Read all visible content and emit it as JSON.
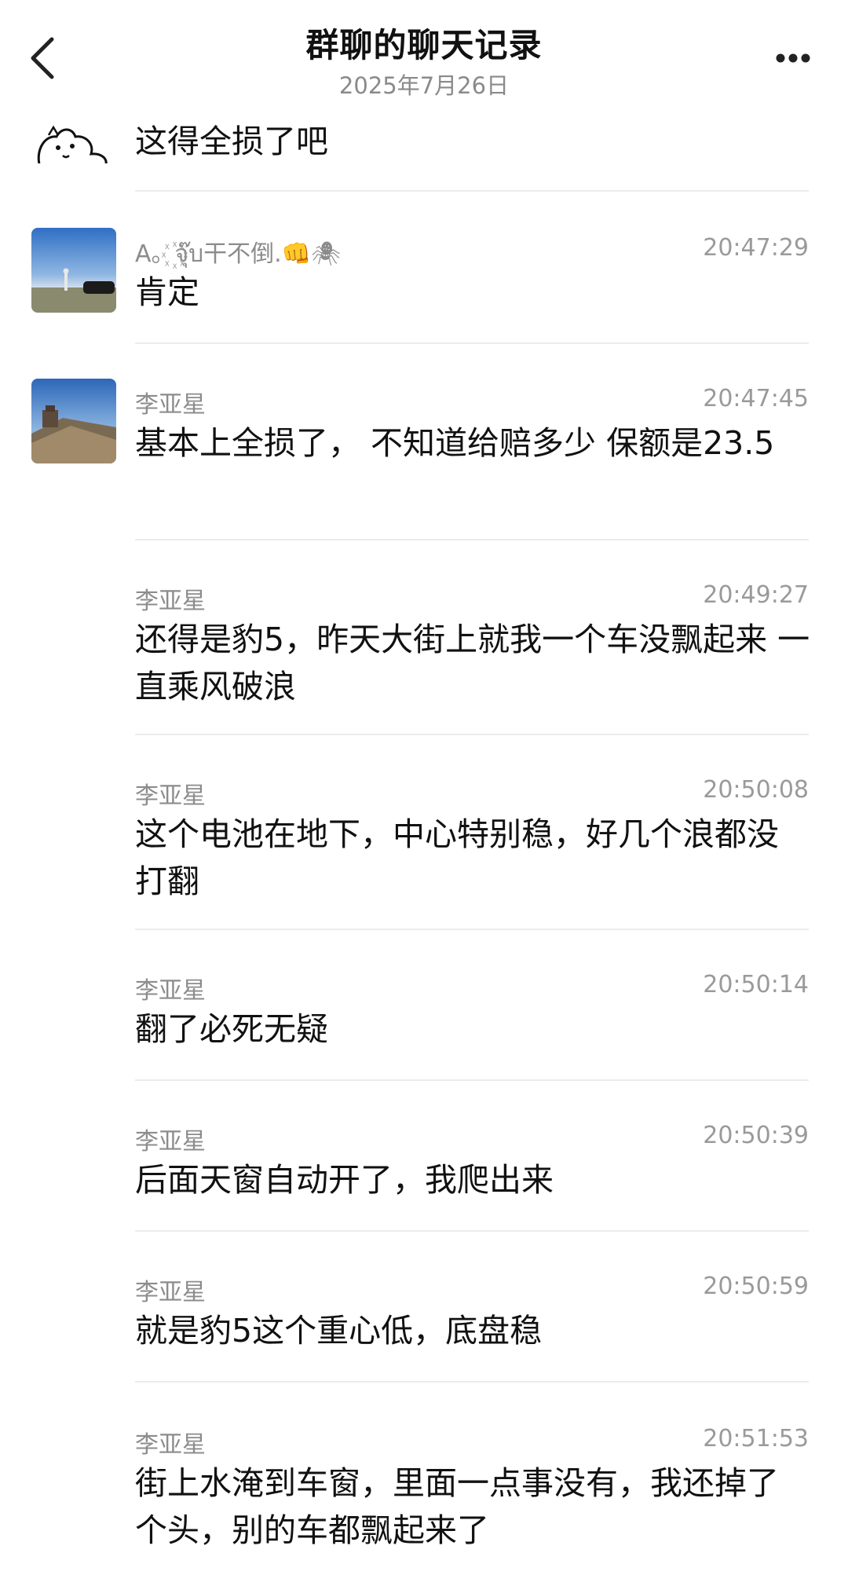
{
  "header": {
    "title": "群聊的聊天记录",
    "date": "2025年7月26日",
    "back_icon": "chevron-left-icon",
    "more_icon": "more-dots-icon"
  },
  "messages": [
    {
      "sender": "",
      "time": "",
      "text": "这得全损了吧"
    },
    {
      "sender": "A。꙰จุ๊บ干不倒.👊🕷",
      "time": "20:47:29",
      "text": "肯定"
    },
    {
      "sender": "李亚星",
      "time": "20:47:45",
      "text": "基本上全损了， 不知道给赔多少 保额是23.5"
    },
    {
      "sender": "李亚星",
      "time": "20:49:27",
      "text": "还得是豹5，昨天大街上就我一个车没飘起来  一直乘风破浪"
    },
    {
      "sender": "李亚星",
      "time": "20:50:08",
      "text": "这个电池在地下，中心特别稳，好几个浪都没打翻"
    },
    {
      "sender": "李亚星",
      "time": "20:50:14",
      "text": "翻了必死无疑"
    },
    {
      "sender": "李亚星",
      "time": "20:50:39",
      "text": "后面天窗自动开了，我爬出来"
    },
    {
      "sender": "李亚星",
      "time": "20:50:59",
      "text": "就是豹5这个重心低，底盘稳"
    },
    {
      "sender": "李亚星",
      "time": "20:51:53",
      "text": "街上水淹到车窗，里面一点事没有，我还掉了个头，别的车都飘起来了"
    }
  ]
}
